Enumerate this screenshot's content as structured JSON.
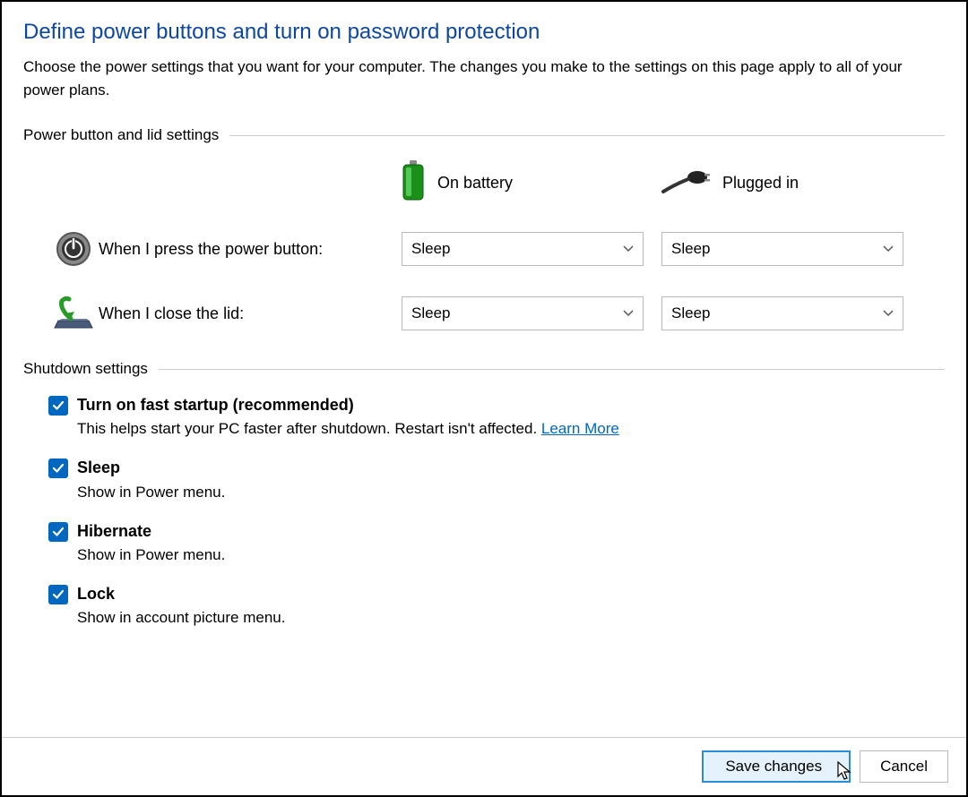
{
  "title": "Define power buttons and turn on password protection",
  "description": "Choose the power settings that you want for your computer. The changes you make to the settings on this page apply to all of your power plans.",
  "sections": {
    "power": {
      "title": "Power button and lid settings",
      "columns": {
        "battery": "On battery",
        "plugged": "Plugged in"
      },
      "rows": [
        {
          "label": "When I press the power button:",
          "battery_value": "Sleep",
          "plugged_value": "Sleep"
        },
        {
          "label": "When I close the lid:",
          "battery_value": "Sleep",
          "plugged_value": "Sleep"
        }
      ]
    },
    "shutdown": {
      "title": "Shutdown settings",
      "items": [
        {
          "title": "Turn on fast startup (recommended)",
          "desc": "This helps start your PC faster after shutdown. Restart isn't affected. ",
          "link": "Learn More",
          "checked": true
        },
        {
          "title": "Sleep",
          "desc": "Show in Power menu.",
          "checked": true
        },
        {
          "title": "Hibernate",
          "desc": "Show in Power menu.",
          "checked": true
        },
        {
          "title": "Lock",
          "desc": "Show in account picture menu.",
          "checked": true
        }
      ]
    }
  },
  "buttons": {
    "save": "Save changes",
    "cancel": "Cancel"
  }
}
